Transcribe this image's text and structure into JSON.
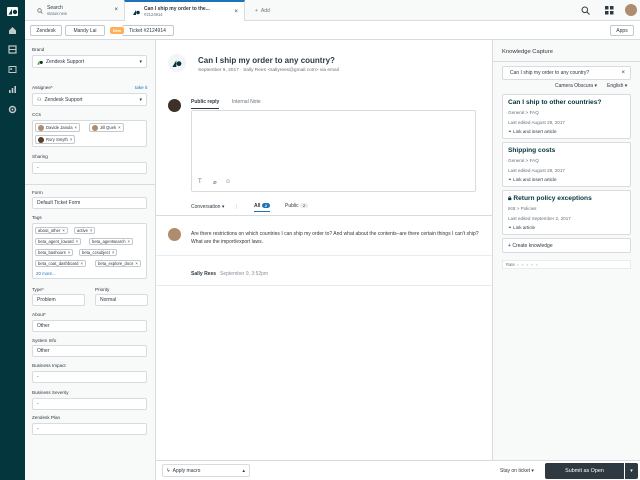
{
  "nav": {
    "items": [
      "home-icon",
      "views-icon",
      "customers-icon",
      "reports-icon",
      "admin-icon"
    ]
  },
  "tabs": [
    {
      "title": "Search",
      "subtitle": "status:new"
    },
    {
      "title": "Can I ship my order to the...",
      "subtitle": "#2124914"
    }
  ],
  "add_tab_label": "Add",
  "subnav": {
    "org": "Zendesk",
    "user": "Mandy Lai",
    "badge": "New",
    "ticket": "Ticket #2124914",
    "apps": "Apps"
  },
  "left": {
    "brand_label": "Brand",
    "brand_value": "Zendesk Support",
    "assignee_label": "Assignee*",
    "take_it": "take it",
    "assignee_value": "Zendesk Support",
    "ccs_label": "CCs",
    "ccs": [
      "Davide Janula",
      "Jill Quek",
      "Rory Smyth"
    ],
    "sharing_label": "Sharing",
    "sharing_value": "-",
    "form_label": "Form",
    "form_value": "Default Ticket Form",
    "tags_label": "Tags",
    "tags": [
      "about_other",
      "active",
      "beta_agent_loward",
      "beta_agentsearch",
      "beta_bashours",
      "beta_ccsubject",
      "beta_coat_dashboard",
      "beta_explore_docs"
    ],
    "more_tags": "20 more...",
    "type_label": "Type*",
    "type_value": "Problem",
    "priority_label": "Priority",
    "priority_value": "Normal",
    "about_label": "About*",
    "about_value": "Other",
    "system_label": "System Info",
    "system_value": "Other",
    "impact_label": "Business Impact",
    "impact_value": "-",
    "severity_label": "Business Severity",
    "severity_value": "-",
    "plan_label": "Zendesk Plan",
    "plan_value": "-"
  },
  "ticket": {
    "title": "Can I ship my order to any country?",
    "meta": "September 9, 2017 · Sally Rees <sallyrees@gmail.com> via email",
    "reply_tab": "Public reply",
    "note_tab": "Internal Note",
    "conversation": "Conversation",
    "all": "All",
    "all_count": "2",
    "public": "Public",
    "public_count": "2",
    "comment_text": "Are there restrictions on which countries I can ship my order to? And what about the contents–are there certain things I can't ship? What are the import/export laws.",
    "author": "Sally Rees",
    "author_time": "September 9, 3:52pm"
  },
  "knowledge": {
    "title": "Knowledge Capture",
    "search_value": "Can I ship my order to any country?",
    "filter_brand": "Camera Obscura",
    "filter_lang": "English",
    "articles": [
      {
        "title": "Can I ship to other countries?",
        "path": "General > FAQ",
        "edited": "Last edited August 29, 2017",
        "action": "Link and insert article"
      },
      {
        "title": "Shipping costs",
        "path": "General > FAQ",
        "edited": "Last edited August 28, 2017",
        "action": "Link and insert article"
      },
      {
        "title": "Return policy exceptions",
        "path": "IKB > Policies",
        "edited": "Last edited September 2, 2017",
        "action": "Link article"
      }
    ],
    "create": "Create knowledge",
    "rate_label": "Rate"
  },
  "footer": {
    "macro": "Apply macro",
    "stay": "Stay on ticket",
    "submit": "Submit as Open"
  },
  "colors": {
    "nav": "#03363d",
    "accent": "#1f73b7",
    "badge": "#ffb057",
    "submit": "#2f3941"
  }
}
